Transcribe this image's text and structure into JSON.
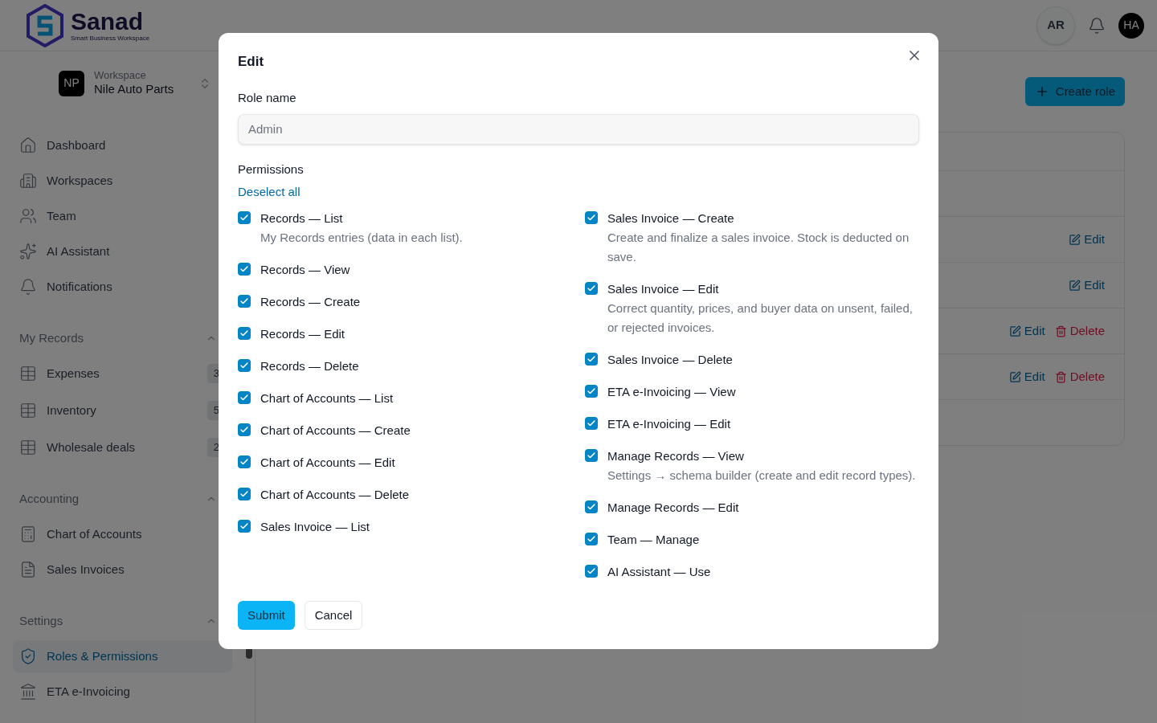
{
  "header": {
    "logo": {
      "name": "Sanad",
      "tagline": "Smart Business Workspace"
    },
    "language_button": "AR",
    "avatar": "HA"
  },
  "workspace": {
    "initials": "NP",
    "label": "Workspace",
    "name": "Nile Auto Parts"
  },
  "sidebar": {
    "items": [
      {
        "label": "Dashboard",
        "selected": false
      },
      {
        "label": "Workspaces",
        "selected": false
      },
      {
        "label": "Team",
        "selected": false
      },
      {
        "label": "AI Assistant",
        "selected": false
      },
      {
        "label": "Notifications",
        "selected": false
      }
    ],
    "sections": [
      {
        "title": "My Records",
        "expanded": true,
        "items": [
          {
            "label": "Expenses",
            "count": "3",
            "selected": false
          },
          {
            "label": "Inventory",
            "count": "5",
            "selected": false
          },
          {
            "label": "Wholesale deals",
            "count": "2",
            "selected": false
          }
        ]
      },
      {
        "title": "Accounting",
        "expanded": true,
        "items": [
          {
            "label": "Chart of Accounts",
            "selected": false
          },
          {
            "label": "Sales Invoices",
            "selected": false
          }
        ]
      },
      {
        "title": "Settings",
        "expanded": true,
        "items": [
          {
            "label": "Roles & Permissions",
            "selected": true
          },
          {
            "label": "ETA e-Invoicing",
            "selected": false
          }
        ]
      }
    ]
  },
  "main": {
    "create_button": "Create role",
    "table": {
      "rows": [
        {
          "kind": "header"
        },
        {
          "kind": "blank"
        },
        {
          "kind": "actions",
          "actions": [
            {
              "kind": "edit",
              "label": "Edit"
            }
          ]
        },
        {
          "kind": "actions",
          "actions": [
            {
              "kind": "edit",
              "label": "Edit"
            }
          ]
        },
        {
          "kind": "actions",
          "actions": [
            {
              "kind": "edit",
              "label": "Edit"
            },
            {
              "kind": "delete",
              "label": "Delete"
            }
          ]
        },
        {
          "kind": "actions",
          "actions": [
            {
              "kind": "edit",
              "label": "Edit"
            },
            {
              "kind": "delete",
              "label": "Delete"
            }
          ]
        },
        {
          "kind": "blank"
        }
      ]
    }
  },
  "dialog": {
    "title": "Edit",
    "role_name_label": "Role name",
    "role_name_placeholder": "Admin",
    "permissions_label": "Permissions",
    "deselect_all": "Deselect all",
    "columns": [
      [
        {
          "label": "Records — List",
          "description": "My Records entries (data in each list).",
          "checked": true
        },
        {
          "label": "Records — View",
          "checked": true
        },
        {
          "label": "Records — Create",
          "checked": true
        },
        {
          "label": "Records — Edit",
          "checked": true
        },
        {
          "label": "Records — Delete",
          "checked": true
        },
        {
          "label": "Chart of Accounts — List",
          "checked": true
        },
        {
          "label": "Chart of Accounts — Create",
          "checked": true
        },
        {
          "label": "Chart of Accounts — Edit",
          "checked": true
        },
        {
          "label": "Chart of Accounts — Delete",
          "checked": true
        },
        {
          "label": "Sales Invoice — List",
          "checked": true
        }
      ],
      [
        {
          "label": "Sales Invoice — Create",
          "description": "Create and finalize a sales invoice. Stock is deducted on save.",
          "checked": true
        },
        {
          "label": "Sales Invoice — Edit",
          "description": "Correct quantity, prices, and buyer data on unsent, failed, or rejected invoices.",
          "checked": true
        },
        {
          "label": "Sales Invoice — Delete",
          "checked": true
        },
        {
          "label": "ETA e-Invoicing — View",
          "checked": true
        },
        {
          "label": "ETA e-Invoicing — Edit",
          "checked": true
        },
        {
          "label": "Manage Records — View",
          "description": "Settings → schema builder (create and edit record types).",
          "checked": true
        },
        {
          "label": "Manage Records — Edit",
          "checked": true
        },
        {
          "label": "Team — Manage",
          "checked": true
        },
        {
          "label": "AI Assistant — Use",
          "checked": true
        }
      ]
    ],
    "submit": "Submit",
    "cancel": "Cancel"
  }
}
